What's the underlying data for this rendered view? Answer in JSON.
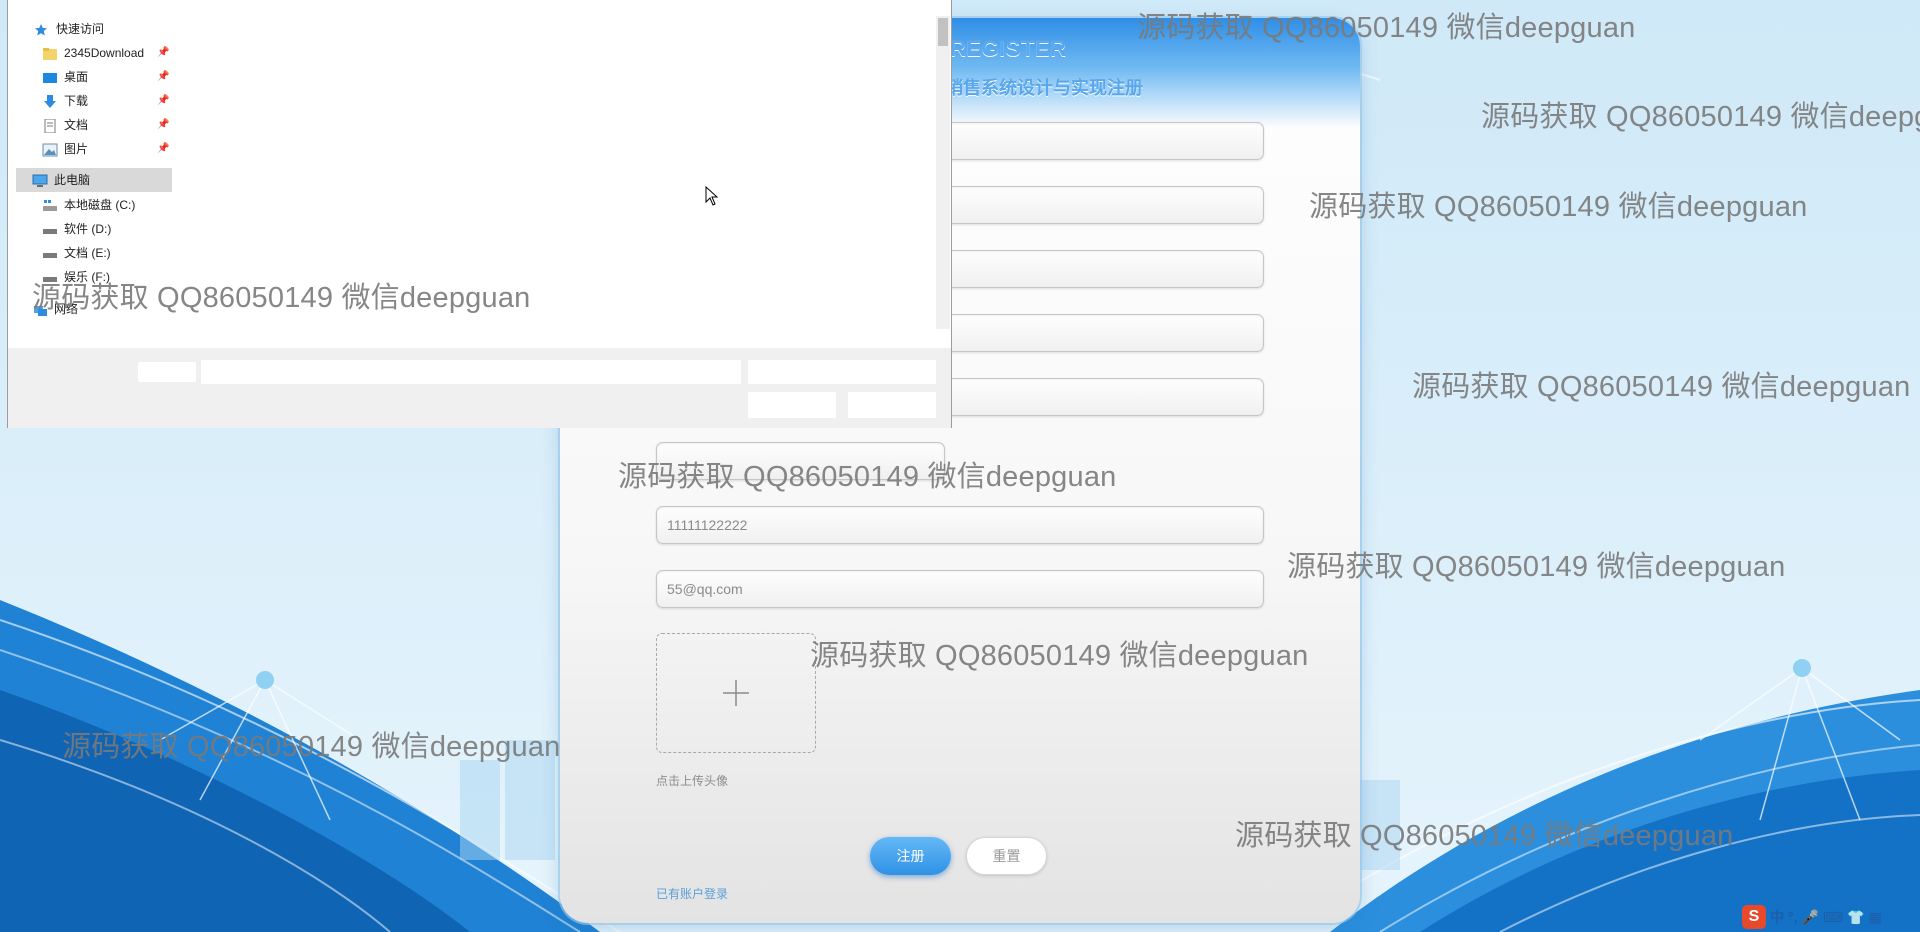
{
  "register": {
    "title_en": "REGISTER",
    "title_cn": "销售系统设计与实现注册",
    "phone_value": "11111122222",
    "email_value": "55@qq.com",
    "upload_hint": "点击上传头像",
    "register_button": "注册",
    "reset_button": "重置",
    "login_link": "已有账户登录"
  },
  "explorer": {
    "quick_access": "快速访问",
    "pinned": [
      {
        "label": "2345Download",
        "icon": "folder-icon"
      },
      {
        "label": "桌面",
        "icon": "desktop-icon"
      },
      {
        "label": "下载",
        "icon": "download-icon"
      },
      {
        "label": "文档",
        "icon": "document-icon"
      },
      {
        "label": "图片",
        "icon": "picture-icon"
      }
    ],
    "this_pc": "此电脑",
    "drives": [
      {
        "label": "本地磁盘 (C:)",
        "icon": "local-disk-icon"
      },
      {
        "label": "软件 (D:)",
        "icon": "drive-icon"
      },
      {
        "label": "文档 (E:)",
        "icon": "drive-icon"
      },
      {
        "label": "娱乐 (F:)",
        "icon": "drive-icon"
      }
    ],
    "network": "网络"
  },
  "watermark": "源码获取 QQ86050149 微信deepguan",
  "tray": {
    "ime_label": "中"
  },
  "colors": {
    "accent": "#3a9be9",
    "card_bg": "#f7f7f7",
    "sky": "#d8eef9",
    "wave": "#1f82d4"
  }
}
